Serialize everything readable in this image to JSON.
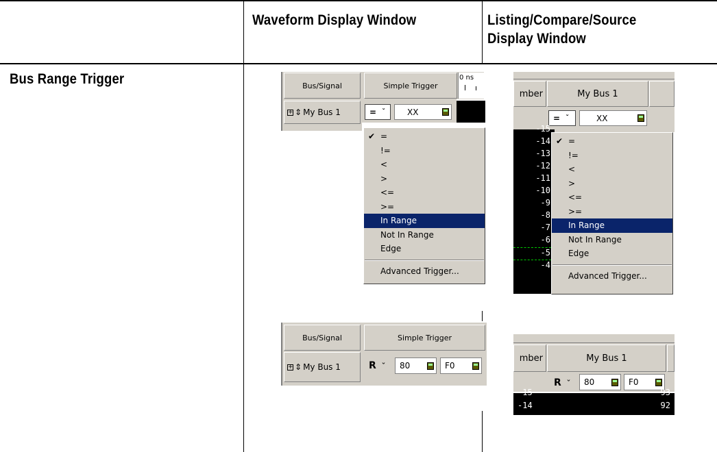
{
  "table": {
    "col_headers": [
      "",
      "Waveform Display Window",
      "Listing/Compare/Source Display Window"
    ],
    "header_col3_line1": "Listing/Compare/Source",
    "header_col3_line2": "Display Window",
    "row_label": "Bus Range Trigger"
  },
  "waveform_top": {
    "col_bus_signal": "Bus/Signal",
    "col_simple_trigger": "Simple Trigger",
    "time_label": "0 ns",
    "bus_name": "My Bus 1",
    "operator": "=",
    "value": "XX",
    "menu_items": [
      "=",
      "!=",
      "<",
      ">",
      "<=",
      ">=",
      "In Range",
      "Not In Range",
      "Edge"
    ],
    "menu_checked": "=",
    "menu_selected": "In Range",
    "menu_advanced": "Advanced Trigger..."
  },
  "listing_top": {
    "col_number_partial": "mber",
    "col_bus": "My Bus 1",
    "operator": "=",
    "value": "XX",
    "row_numbers": [
      "-15",
      "-14",
      "-13",
      "-12",
      "-11",
      "-10",
      "-9",
      "-8",
      "-7",
      "-6",
      "-5",
      "-4"
    ],
    "menu_items": [
      "=",
      "!=",
      "<",
      ">",
      "<=",
      ">=",
      "In Range",
      "Not In Range",
      "Edge"
    ],
    "menu_checked": "=",
    "menu_selected": "In Range",
    "menu_advanced": "Advanced Trigger..."
  },
  "waveform_bottom": {
    "col_bus_signal": "Bus/Signal",
    "col_simple_trigger": "Simple Trigger",
    "bus_name": "My Bus 1",
    "operator": "R",
    "value_low": "80",
    "value_high": "F0"
  },
  "listing_bottom": {
    "col_number_partial": "mber",
    "col_bus": "My Bus 1",
    "operator": "R",
    "value_low": "80",
    "value_high": "F0",
    "rows": [
      {
        "num": "-15",
        "val": "93"
      },
      {
        "num": "-14",
        "val": "92"
      }
    ]
  }
}
